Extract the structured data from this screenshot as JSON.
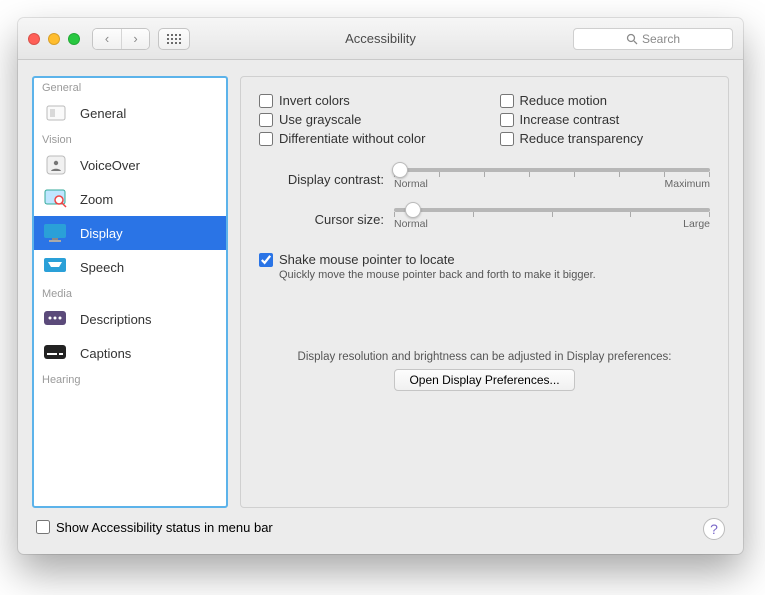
{
  "header": {
    "title": "Accessibility",
    "search_placeholder": "Search"
  },
  "sidebar": {
    "sections": [
      {
        "label": "General",
        "items": [
          {
            "label": "General"
          }
        ]
      },
      {
        "label": "Vision",
        "items": [
          {
            "label": "VoiceOver"
          },
          {
            "label": "Zoom"
          },
          {
            "label": "Display",
            "selected": true
          },
          {
            "label": "Speech"
          }
        ]
      },
      {
        "label": "Media",
        "items": [
          {
            "label": "Descriptions"
          },
          {
            "label": "Captions"
          }
        ]
      },
      {
        "label": "Hearing",
        "items": []
      }
    ]
  },
  "options": {
    "left": [
      {
        "key": "invert",
        "label": "Invert colors"
      },
      {
        "key": "gray",
        "label": "Use grayscale"
      },
      {
        "key": "diffcol",
        "label": "Differentiate without color"
      }
    ],
    "right": [
      {
        "key": "motion",
        "label": "Reduce motion"
      },
      {
        "key": "contrast",
        "label": "Increase contrast"
      },
      {
        "key": "transp",
        "label": "Reduce transparency"
      }
    ]
  },
  "sliders": {
    "contrast": {
      "label": "Display contrast:",
      "min_label": "Normal",
      "max_label": "Maximum",
      "value_pct": 2
    },
    "cursor": {
      "label": "Cursor size:",
      "min_label": "Normal",
      "max_label": "Large",
      "value_pct": 6
    }
  },
  "shake": {
    "checked": true,
    "label": "Shake mouse pointer to locate",
    "desc": "Quickly move the mouse pointer back and forth to make it bigger."
  },
  "footer": {
    "text": "Display resolution and brightness can be adjusted in Display preferences:",
    "button": "Open Display Preferences..."
  },
  "menubar_checkbox": "Show Accessibility status in menu bar"
}
